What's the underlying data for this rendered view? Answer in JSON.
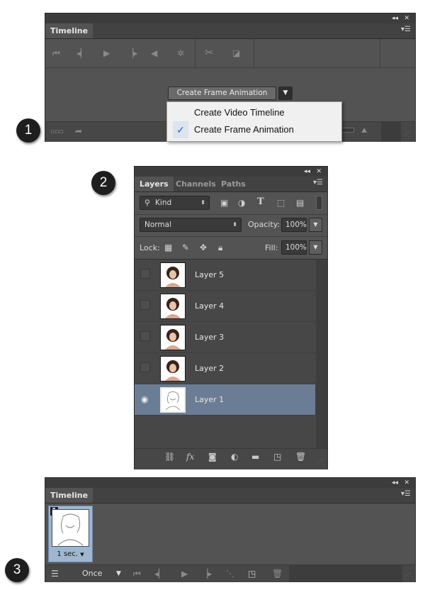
{
  "panel1": {
    "title": "Timeline",
    "create_button": "Create Frame Animation",
    "dropdown_items": [
      {
        "label": "Create Video Timeline",
        "checked": false
      },
      {
        "label": "Create Frame Animation",
        "checked": true
      }
    ],
    "checkmark": "✓"
  },
  "panel2": {
    "tabs": [
      "Layers",
      "Channels",
      "Paths"
    ],
    "filter_label": "Kind",
    "blend_mode": "Normal",
    "opacity_label": "Opacity:",
    "opacity_value": "100%",
    "lock_label": "Lock:",
    "fill_label": "Fill:",
    "fill_value": "100%",
    "layers": [
      {
        "name": "Layer 5",
        "visible": false,
        "selected": false
      },
      {
        "name": "Layer 4",
        "visible": false,
        "selected": false
      },
      {
        "name": "Layer 3",
        "visible": false,
        "selected": false
      },
      {
        "name": "Layer 2",
        "visible": false,
        "selected": false
      },
      {
        "name": "Layer 1",
        "visible": true,
        "selected": true
      }
    ]
  },
  "panel3": {
    "title": "Timeline",
    "frame_number": "1",
    "frame_delay": "1 sec.",
    "loop": "Once"
  },
  "badges": [
    "1",
    "2",
    "3"
  ],
  "colors": {
    "panel_bg": "#535353",
    "dark_bar": "#3c3c3c",
    "selected_layer": "#6b7d94",
    "selected_frame": "#9fb6cf",
    "check": "#2a63c9"
  }
}
